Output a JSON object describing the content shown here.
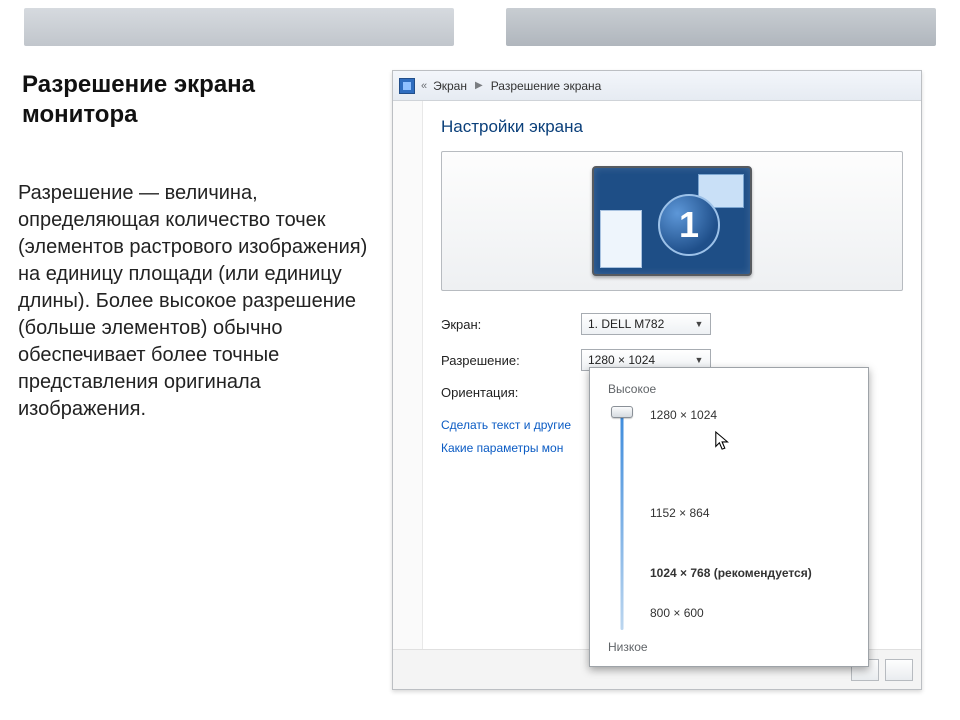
{
  "title": "Разрешение экрана монитора",
  "body": "Разрешение — величина, определяющая количество точек (элементов растрового изображения) на единицу площади (или единицу длины). Более высокое разрешение (больше элементов) обычно обеспечивает более точные представления оригинала изображения.",
  "breadcrumb": {
    "root": "Экран",
    "current": "Разрешение экрана"
  },
  "section_title": "Настройки экрана",
  "monitor_number": "1",
  "rows": {
    "screen_label": "Экран:",
    "screen_value": "1. DELL M782",
    "res_label": "Разрешение:",
    "res_value": "1280 × 1024",
    "orient_label": "Ориентация:"
  },
  "links": {
    "text_size": "Сделать текст и другие",
    "params": "Какие параметры мон"
  },
  "popup": {
    "top_label": "Высокое",
    "bottom_label": "Низкое",
    "options": {
      "o1": "1280 × 1024",
      "o2": "1152 × 864",
      "o3": "1024 × 768 (рекомендуется)",
      "o4": "800 × 600"
    }
  }
}
